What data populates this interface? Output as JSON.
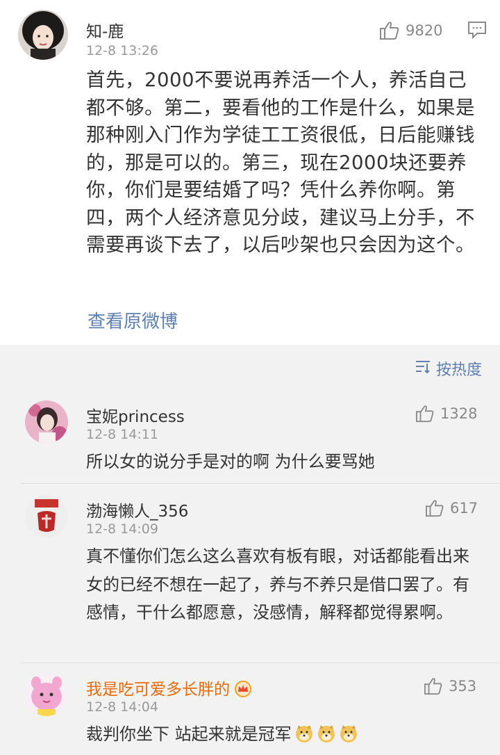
{
  "main_post": {
    "user": "知-鹿",
    "time": "12-8 13:26",
    "likes": "9820",
    "body": "首先，2000不要说再养活一个人，养活自己都不够。第二，要看他的工作是什么，如果是那种刚入门作为学徒工工资很低，日后能赚钱的，那是可以的。第三，现在2000块还要养你，你们是要结婚了吗？凭什么养你啊。第四，两个人经济意见分歧，建议马上分手，不需要再谈下去了，以后吵架也只会因为这个。",
    "view_original": "查看原微博"
  },
  "sort": {
    "label": "按热度",
    "icon": "sort-icon"
  },
  "comments": [
    {
      "user": "宝妮princess",
      "time": "12-8 14:11",
      "likes": "1328",
      "text": "所以女的说分手是对的啊 为什么要骂她"
    },
    {
      "user": "渤海懒人_356",
      "time": "12-8 14:09",
      "likes": "617",
      "text": "真不懂你们怎么这么喜欢有板有眼，对话都能看出来女的已经不想在一起了，养与不养只是借口罢了。有感情，干什么都愿意，没感情，解释都觉得累啊。"
    },
    {
      "user": "我是吃可爱多长胖的",
      "time": "12-8 14:04",
      "likes": "353",
      "text": "裁判你坐下 站起来就是冠军",
      "vip": true,
      "emoji": [
        "doge-emoji",
        "doge-emoji",
        "doge-emoji"
      ]
    }
  ],
  "colors": {
    "link": "#5e7fb0",
    "vip_name": "#e86b0a",
    "meta": "#999999"
  }
}
